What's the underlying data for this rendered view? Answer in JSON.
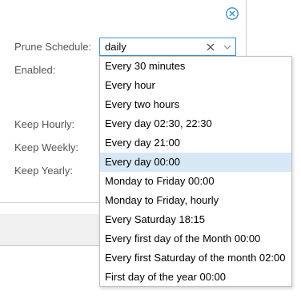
{
  "form": {
    "prune_schedule_label": "Prune Schedule:",
    "enabled_label": "Enabled:",
    "keep_hourly_label": "Keep Hourly:",
    "keep_weekly_label": "Keep Weekly:",
    "keep_yearly_label": "Keep Yearly:"
  },
  "schedule_combo": {
    "value": "daily",
    "clear_icon": "clear-x-icon",
    "trigger_icon": "chevron-down-icon"
  },
  "dropdown": {
    "selected_index": 5,
    "options": [
      "Every 30 minutes",
      "Every hour",
      "Every two hours",
      "Every day 02:30, 22:30",
      "Every day 21:00",
      "Every day 00:00",
      "Monday to Friday 00:00",
      "Monday to Friday, hourly",
      "Every Saturday 18:15",
      "Every first day of the Month 00:00",
      "Every first Saturday of the month 02:00",
      "First day of the year 00:00"
    ]
  },
  "icons": {
    "close": "close-circle-icon"
  },
  "colors": {
    "accent": "#3892d4",
    "selected_bg": "#d6e8f6",
    "close_icon": "#3892d4"
  }
}
